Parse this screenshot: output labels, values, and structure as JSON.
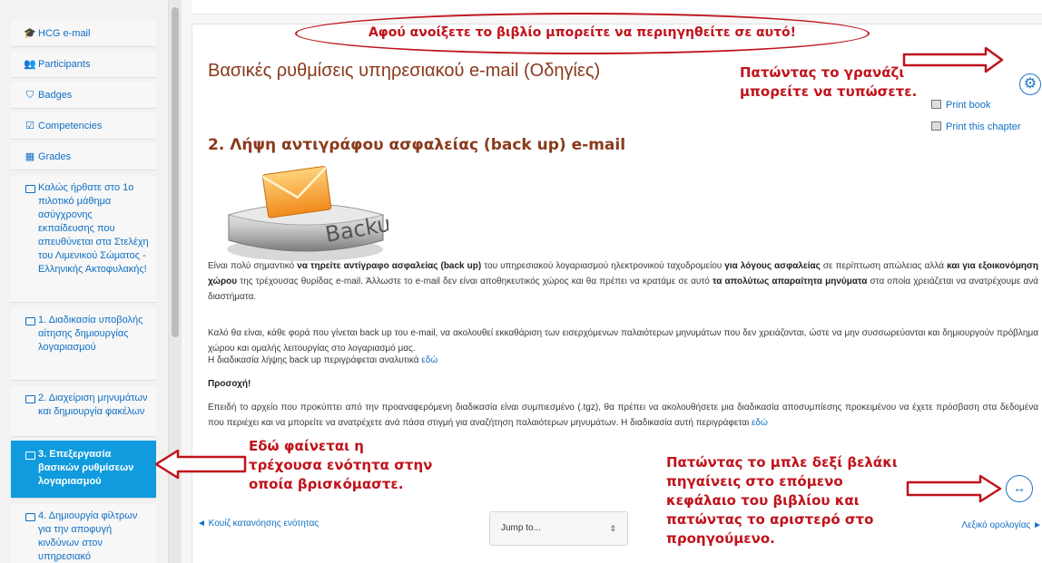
{
  "sidebar": {
    "items": [
      {
        "icon": "graduation-cap-icon",
        "label": "HCG e-mail"
      },
      {
        "icon": "users-icon",
        "label": "Participants"
      },
      {
        "icon": "shield-icon",
        "label": "Badges"
      },
      {
        "icon": "checkbox-icon",
        "label": "Competencies"
      },
      {
        "icon": "table-icon",
        "label": "Grades"
      }
    ],
    "sections": [
      {
        "icon": "folder-icon",
        "label": "Καλώς ήρθατε στο 1ο πιλοτικό μάθημα ασύγχρονης εκπαίδευσης που απευθύνεται στα Στελέχη του Λιμενικού Σώματος - Ελληνικής Ακτοφυλακής!",
        "active": false
      },
      {
        "icon": "folder-icon",
        "label": "1. Διαδικασία υποβολής αίτησης δημιουργίας λογαριασμού",
        "active": false
      },
      {
        "icon": "folder-icon",
        "label": "2. Διαχείριση μηνυμάτων και δημιουργία φακέλων",
        "active": false
      },
      {
        "icon": "folder-icon",
        "label": "3. Επεξεργασία βασικών ρυθμίσεων λογαριασμού",
        "active": true
      },
      {
        "icon": "folder-icon",
        "label": "4. Δημιουργία φίλτρων για την αποφυγή κινδύνων στον υπηρεσιακό",
        "active": false
      }
    ]
  },
  "book": {
    "title": "Βασικές ρυθμίσεις υπηρεσιακού e-mail (Οδηγίες)",
    "chapter_title": "2. Λήψη αντιγράφου ασφαλείας (back up) e-mail",
    "image_text": "Backup",
    "print_menu": [
      "Print book",
      "Print this chapter"
    ],
    "paragraphs": {
      "p1_a": "Είναι πολύ σημαντικό ",
      "p1_b": "να τηρείτε αντίγραφο ασφαλείας (back up)",
      "p1_c": " του υπηρεσιακού λογαριασμού ηλεκτρονικού ταχυδρομείου ",
      "p1_d": "για λόγους ασφαλείας",
      "p1_e": " σε περίπτωση απώλειας αλλά ",
      "p1_f": "και για εξοικονόμηση χώρου",
      "p1_g": " της τρέχουσας θυρίδας e-mail. Άλλωστε το e-mail δεν είναι αποθηκευτικός χώρος και θα πρέπει να κρατάμε σε αυτό ",
      "p1_h": "τα απολύτως απαραίτητα μηνύματα",
      "p1_i": " στα οποία χρειάζεται να ανατρέχουμε ανά διαστήματα.",
      "p2": "Καλό θα είναι, κάθε φορά που γίνεται back up του e-mail, να ακολουθεί εκκαθάριση των εισερχόμενων παλαιότερων μηνυμάτων που δεν χρειάζονται, ώστε να μην συσσωρεύονται και δημιουργούν πρόβλημα χώρου και ομαλής λειτουργίας στο λογαριασμό μας.",
      "p3": "Η διαδικασία λήψης back up περιγράφεται αναλυτικά ",
      "p3_link": "εδώ",
      "p4": "Προσοχή!",
      "p5": "Επειδή το αρχείο που προκύπτει από την προαναφερόμενη διαδικασία είναι συμπιεσμένο (.tgz), θα πρέπει να ακολουθήσετε μια διαδικασία αποσυμπίεσης προκειμένου να έχετε πρόσβαση στα δεδομένα που περιέχει και να μπορείτε να ανατρέχετε ανά πάσα στιγμή για αναζήτηση παλαιότερων μηνυμάτων. Η διαδικασία αυτή περιγράφεται ",
      "p5_link": "εδώ"
    },
    "prev_link": "◄ Κουίζ κατανόησης ενότητας",
    "next_link": "Λεξικό ορολογίας ►",
    "jump_placeholder": "Jump to...",
    "jump_caret": "⇕",
    "gear_glyph": "⚙",
    "arrows_glyph": "↔"
  },
  "annotations": {
    "top": "Αφού ανοίξετε το βιβλίο μπορείτε να περιηγηθείτε σε αυτό!",
    "gear": "Πατώντας το γρανάζι μπορείτε να τυπώσετε.",
    "current_section": "Εδώ φαίνεται η τρέχουσα ενότητα στην οποία βρισκόμαστε.",
    "arrows": "Πατώντας το μπλε δεξί βελάκι πηγαίνεις στο επόμενο κεφάλαιο του βιβλίου και πατώντας το αριστερό στο προηγούμενο."
  },
  "colors": {
    "annotation": "#c0131b",
    "accent": "#0f9bde",
    "link": "#0f6fc5",
    "title": "#8a3a1c"
  }
}
